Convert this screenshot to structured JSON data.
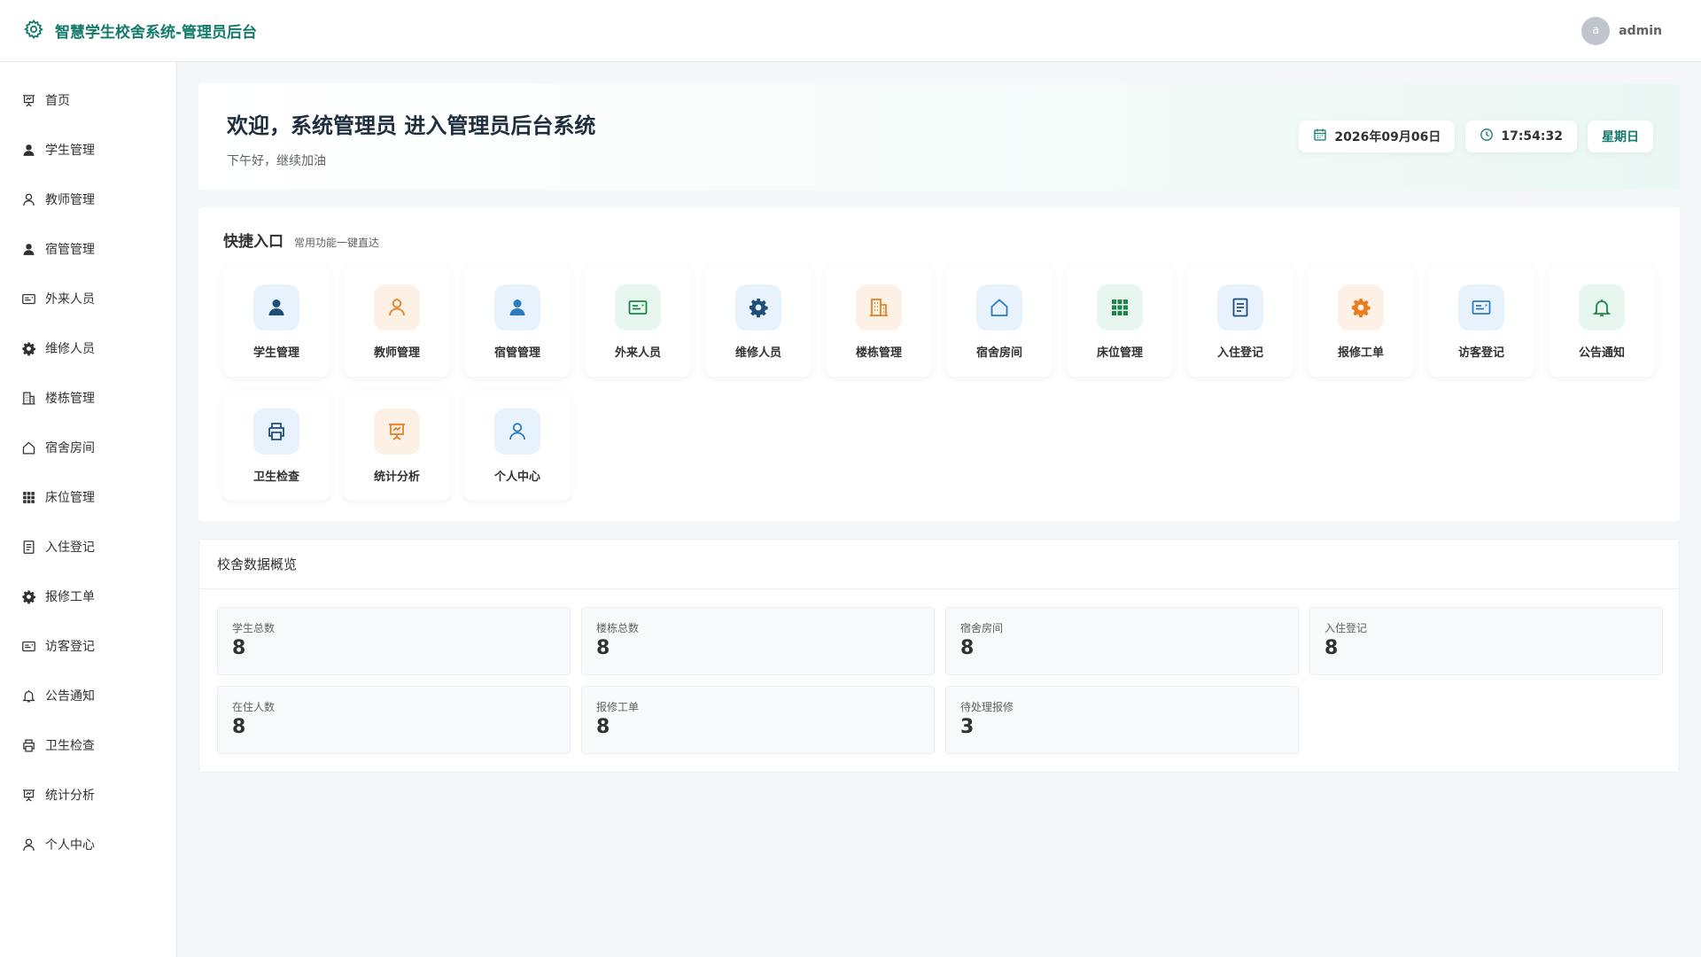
{
  "app": {
    "title": "智慧学生校舍系统-管理员后台",
    "user": {
      "avatar_letter": "a",
      "name": "admin"
    },
    "accent": "#137a6a"
  },
  "sidebar": {
    "items": [
      {
        "label": "首页",
        "icon": "dashboard-icon"
      },
      {
        "label": "学生管理",
        "icon": "user-solid-icon"
      },
      {
        "label": "教师管理",
        "icon": "user-outline-icon"
      },
      {
        "label": "宿管管理",
        "icon": "user-solid-icon"
      },
      {
        "label": "外来人员",
        "icon": "id-card-icon"
      },
      {
        "label": "维修人员",
        "icon": "gear-icon"
      },
      {
        "label": "楼栋管理",
        "icon": "building-icon"
      },
      {
        "label": "宿舍房间",
        "icon": "house-icon"
      },
      {
        "label": "床位管理",
        "icon": "grid-icon"
      },
      {
        "label": "入住登记",
        "icon": "document-icon"
      },
      {
        "label": "报修工单",
        "icon": "gear-icon"
      },
      {
        "label": "访客登记",
        "icon": "id-card-icon"
      },
      {
        "label": "公告通知",
        "icon": "bell-icon"
      },
      {
        "label": "卫生检查",
        "icon": "printer-icon"
      },
      {
        "label": "统计分析",
        "icon": "presentation-icon"
      },
      {
        "label": "个人中心",
        "icon": "user-outline-icon"
      }
    ]
  },
  "welcome": {
    "title": "欢迎，系统管理员 进入管理员后台系统",
    "subtitle": "下午好，继续加油",
    "date": "2026年09月06日",
    "time": "17:54:32",
    "weekday": "星期日"
  },
  "quick": {
    "title": "快捷入口",
    "subtitle": "常用功能一键直达",
    "items": [
      {
        "label": "学生管理",
        "icon": "user-solid-icon",
        "bg": "blue",
        "color": "#1f4e79"
      },
      {
        "label": "教师管理",
        "icon": "user-outline-icon",
        "bg": "orange",
        "color": "#e67e22"
      },
      {
        "label": "宿管管理",
        "icon": "user-solid-icon",
        "bg": "blue",
        "color": "#2b7bbf"
      },
      {
        "label": "外来人员",
        "icon": "id-card-icon",
        "bg": "green",
        "color": "#1e8449"
      },
      {
        "label": "维修人员",
        "icon": "gear-icon",
        "bg": "blue",
        "color": "#1f4e79"
      },
      {
        "label": "楼栋管理",
        "icon": "building-icon",
        "bg": "orange",
        "color": "#e67e22"
      },
      {
        "label": "宿舍房间",
        "icon": "house-icon",
        "bg": "blue",
        "color": "#2b7bbf"
      },
      {
        "label": "床位管理",
        "icon": "grid-icon",
        "bg": "green",
        "color": "#1e8449"
      },
      {
        "label": "入住登记",
        "icon": "document-icon",
        "bg": "blue",
        "color": "#1f4e79"
      },
      {
        "label": "报修工单",
        "icon": "gear-icon",
        "bg": "orange",
        "color": "#e67e22"
      },
      {
        "label": "访客登记",
        "icon": "id-card-icon",
        "bg": "blue",
        "color": "#2b7bbf"
      },
      {
        "label": "公告通知",
        "icon": "bell-icon",
        "bg": "green",
        "color": "#1e8449"
      },
      {
        "label": "卫生检查",
        "icon": "printer-icon",
        "bg": "blue",
        "color": "#1f4e79"
      },
      {
        "label": "统计分析",
        "icon": "presentation-icon",
        "bg": "orange",
        "color": "#e67e22"
      },
      {
        "label": "个人中心",
        "icon": "user-outline-icon",
        "bg": "blue",
        "color": "#2b7bbf"
      }
    ]
  },
  "stats": {
    "title": "校舍数据概览",
    "items": [
      {
        "label": "学生总数",
        "value": "8"
      },
      {
        "label": "楼栋总数",
        "value": "8"
      },
      {
        "label": "宿舍房间",
        "value": "8"
      },
      {
        "label": "入住登记",
        "value": "8"
      },
      {
        "label": "在住人数",
        "value": "8"
      },
      {
        "label": "报修工单",
        "value": "8"
      },
      {
        "label": "待处理报修",
        "value": "3"
      }
    ]
  }
}
